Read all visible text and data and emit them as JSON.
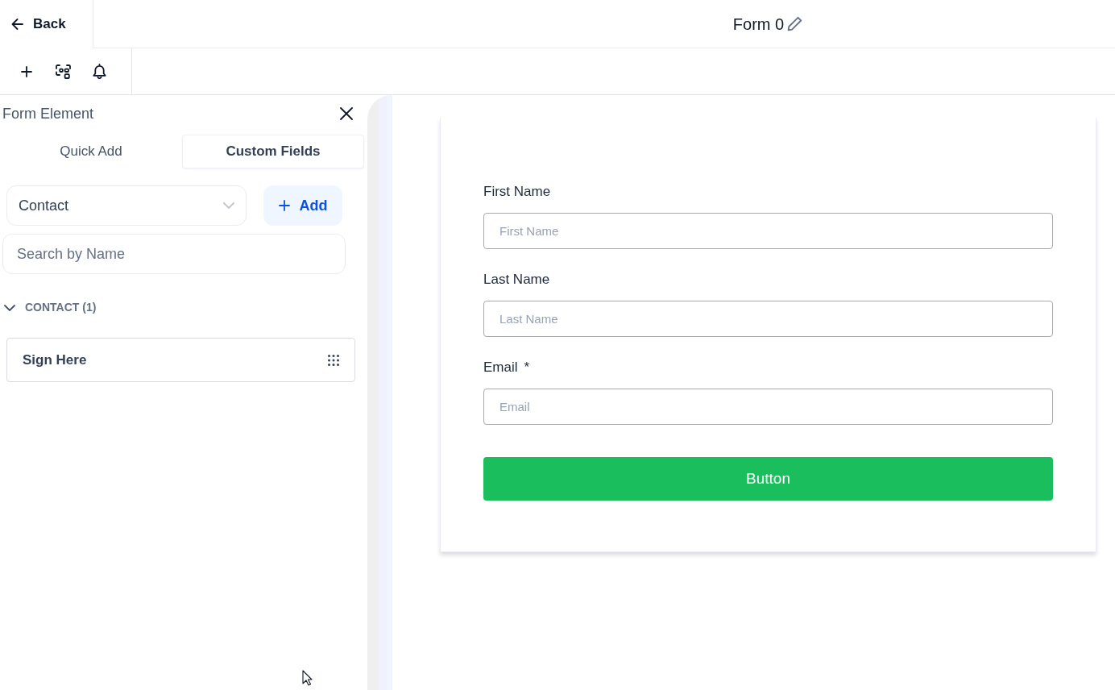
{
  "header": {
    "back_label": "Back",
    "title": "Form 0"
  },
  "panel": {
    "title": "Form Element",
    "tabs": [
      {
        "label": "Quick Add",
        "selected": false
      },
      {
        "label": "Custom Fields",
        "selected": true
      }
    ],
    "object_select": {
      "value": "Contact"
    },
    "add_button": "Add",
    "search": {
      "placeholder": "Search by Name"
    },
    "groups": [
      {
        "label": "CONTACT (1)",
        "expanded": true,
        "items": [
          "Sign Here"
        ]
      }
    ]
  },
  "form": {
    "required_mark": "*",
    "fields": [
      {
        "label": "First Name",
        "placeholder": "First Name",
        "required": false
      },
      {
        "label": "Last Name",
        "placeholder": "Last Name",
        "required": false
      },
      {
        "label": "Email",
        "placeholder": "Email",
        "required": true
      }
    ],
    "submit_button": "Button"
  }
}
